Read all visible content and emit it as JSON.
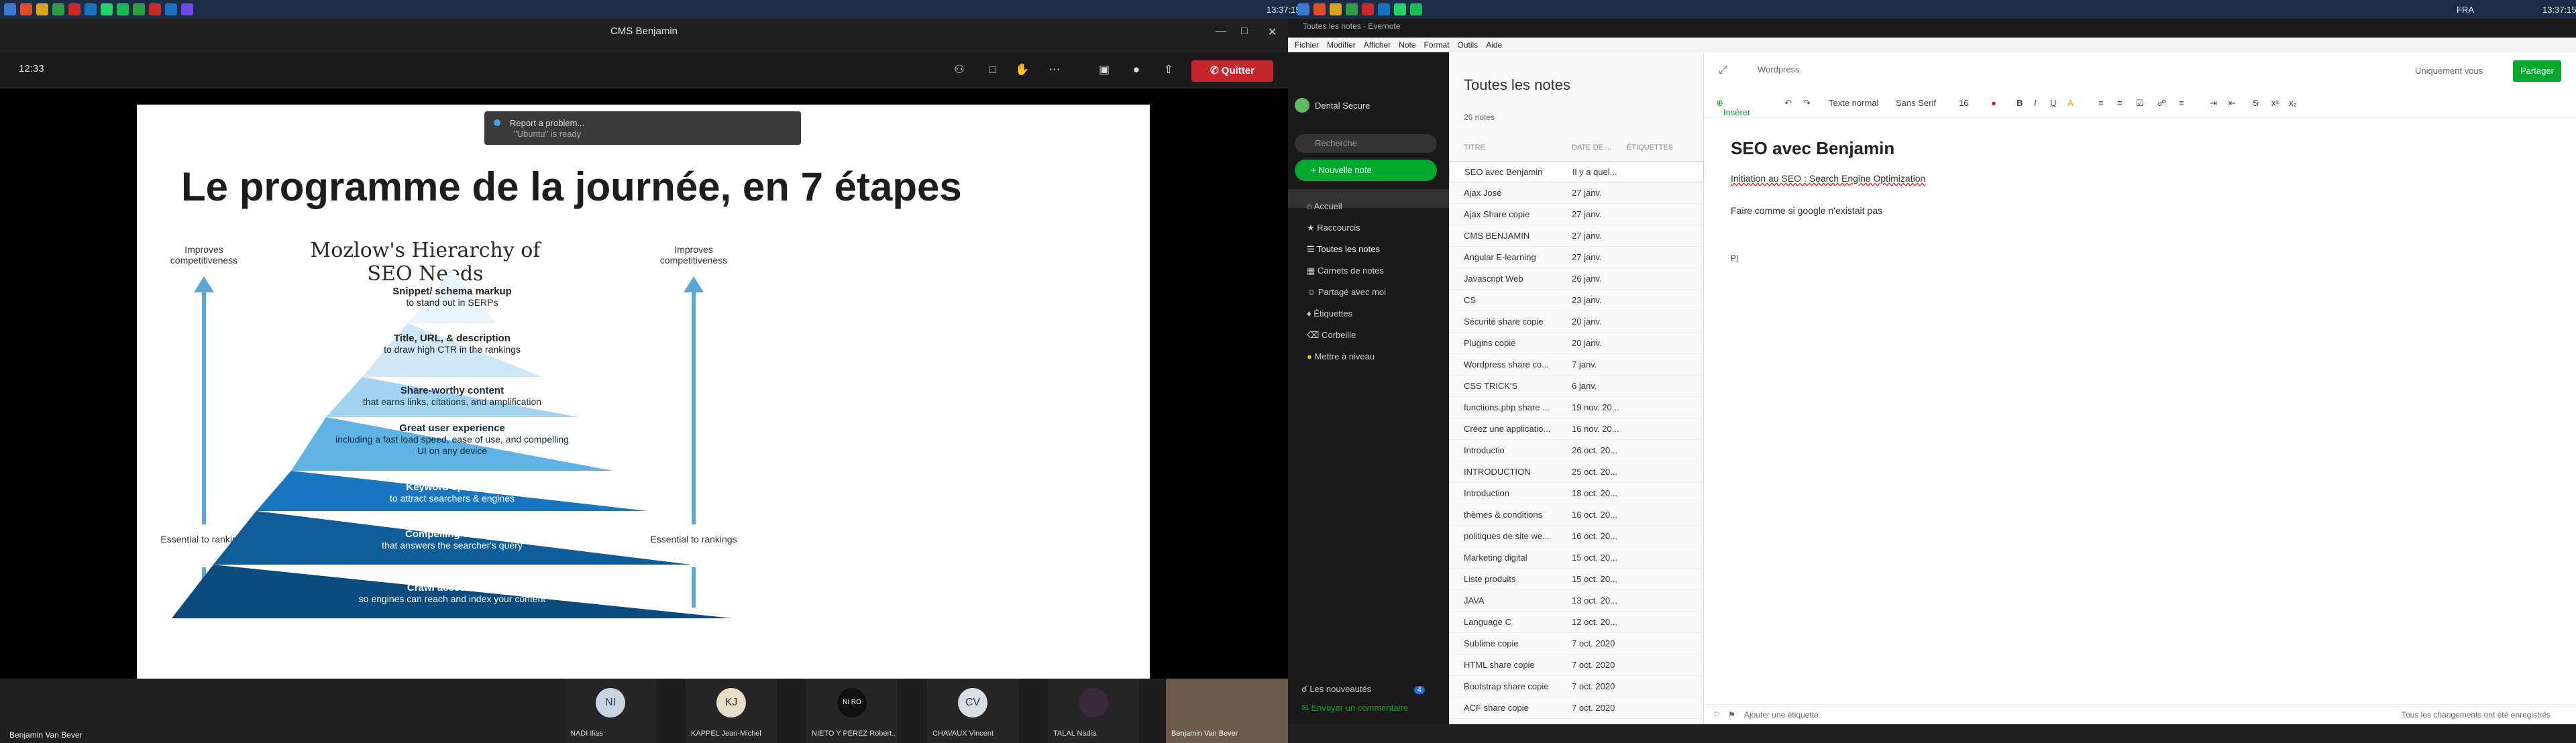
{
  "taskbar": {
    "clock_left": "13:37:15",
    "clock_right": "13:37:15",
    "lang": "FRA"
  },
  "teams": {
    "window_title": "CMS Benjamin",
    "meeting_time": "12:33",
    "quit_label": "Quitter",
    "presenter": "Benjamin Van Bever",
    "toast_title": "Report a problem...",
    "toast_sub": "\"Ubuntu\" is ready",
    "slide": {
      "title": "Le programme de la journée, en 7 étapes",
      "pyramid_title": "Mozlow's Hierarchy of SEO Needs",
      "improves": "Improves competitiveness",
      "essential": "Essential to rankings",
      "tiers": [
        {
          "t": "Snippet/ schema markup",
          "d": "to stand out in SERPs"
        },
        {
          "t": "Title, URL, & description",
          "d": "to draw high CTR in the rankings"
        },
        {
          "t": "Share-worthy content",
          "d": "that earns links, citations, and amplification"
        },
        {
          "t": "Great user experience",
          "d": "including a fast load speed, ease of use, and compelling UI on any device"
        },
        {
          "t": "Keyword optimized",
          "d": "to attract searchers & engines"
        },
        {
          "t": "Compelling content",
          "d": "that answers the searcher's query"
        },
        {
          "t": "Crawl accessibility",
          "d": "so engines can reach and index your content"
        }
      ]
    },
    "participants": [
      {
        "initials": "NI",
        "name": "NADI Ilias",
        "color": "#c8d4e0"
      },
      {
        "initials": "KJ",
        "name": "KAPPEL Jean-Michel",
        "color": "#e8dcc8"
      },
      {
        "initials": "NI RO",
        "name": "NIETO Y PEREZ Robert...",
        "color": "#111111"
      },
      {
        "initials": "CV",
        "name": "CHAVAUX Vincent",
        "color": "#d6dde4"
      },
      {
        "initials": "",
        "name": "TALAL Nadia",
        "color": "#3a2a3a"
      },
      {
        "initials": "",
        "name": "Benjamin Van Bever",
        "color": "#6a5a4a"
      }
    ]
  },
  "evernote": {
    "window_title": "Toutes les notes - Evernote",
    "menu": [
      "Fichier",
      "Modifier",
      "Afficher",
      "Note",
      "Format",
      "Outils",
      "Aide"
    ],
    "user": "Dental Secure",
    "search_placeholder": "Recherche",
    "new_note": "Nouvelle note",
    "nav": [
      "Accueil",
      "Raccourcis",
      "Toutes les notes",
      "Carnets de notes",
      "Partagé avec moi",
      "Étiquettes",
      "Corbeille",
      "Mettre à niveau"
    ],
    "news": "Les nouveautés",
    "news_count": "4",
    "comment": "Envoyer un commentaire",
    "list_title": "Toutes les notes",
    "list_count": "26 notes",
    "col_title": "TITRE",
    "col_date": "DATE DE ...",
    "col_tags": "ÉTIQUETTES",
    "notes": [
      {
        "t": "SEO avec Benjamin",
        "d": "Il y a quel..."
      },
      {
        "t": "Ajax José",
        "d": "27 janv."
      },
      {
        "t": "Ajax Share copie",
        "d": "27 janv."
      },
      {
        "t": "CMS BENJAMIN",
        "d": "27 janv."
      },
      {
        "t": "Angular E-learning",
        "d": "27 janv."
      },
      {
        "t": "Javascript Web",
        "d": "26 janv."
      },
      {
        "t": "CS",
        "d": "23 janv."
      },
      {
        "t": "Sécurité share copie",
        "d": "20 janv."
      },
      {
        "t": "Plugins copie",
        "d": "20 janv."
      },
      {
        "t": "Wordpress share co...",
        "d": "7 janv."
      },
      {
        "t": "CSS TRICK'S",
        "d": "6 janv."
      },
      {
        "t": "functions.php share ...",
        "d": "19 nov. 20..."
      },
      {
        "t": "Créez une applicatio...",
        "d": "16 nov. 20..."
      },
      {
        "t": "Introductio",
        "d": "26 oct. 20..."
      },
      {
        "t": "INTRODUCTION",
        "d": "25 oct. 20..."
      },
      {
        "t": "Introduction",
        "d": "18 oct. 20..."
      },
      {
        "t": "thèmes & conditions",
        "d": "16 oct. 20..."
      },
      {
        "t": "politiques de site we...",
        "d": "16 oct. 20..."
      },
      {
        "t": "Marketing digital",
        "d": "15 oct. 20..."
      },
      {
        "t": "Liste produits",
        "d": "15 oct. 20..."
      },
      {
        "t": "JAVA",
        "d": "13 oct. 20..."
      },
      {
        "t": "Language C",
        "d": "12 oct. 20..."
      },
      {
        "t": "Sublime copie",
        "d": "7 oct. 2020"
      },
      {
        "t": "HTML share copie",
        "d": "7 oct. 2020"
      },
      {
        "t": "Bootstrap share copie",
        "d": "7 oct. 2020"
      },
      {
        "t": "ACF share copie",
        "d": "7 oct. 2020"
      }
    ],
    "editor": {
      "notebook": "Wordpress",
      "only_you": "Uniquement vous",
      "share": "Partager",
      "insert": "Insérer",
      "style": "Texte normal",
      "font": "Sans Serif",
      "size": "16",
      "heading": "SEO avec Benjamin",
      "line1": "Initiation au SEO : Search Engine Optimization",
      "line2": "Faire comme si google n'existait pas",
      "line3": "P|",
      "add_tag": "Ajouter une étiquette",
      "saved": "Tous les changements ont été enregistrés"
    }
  }
}
